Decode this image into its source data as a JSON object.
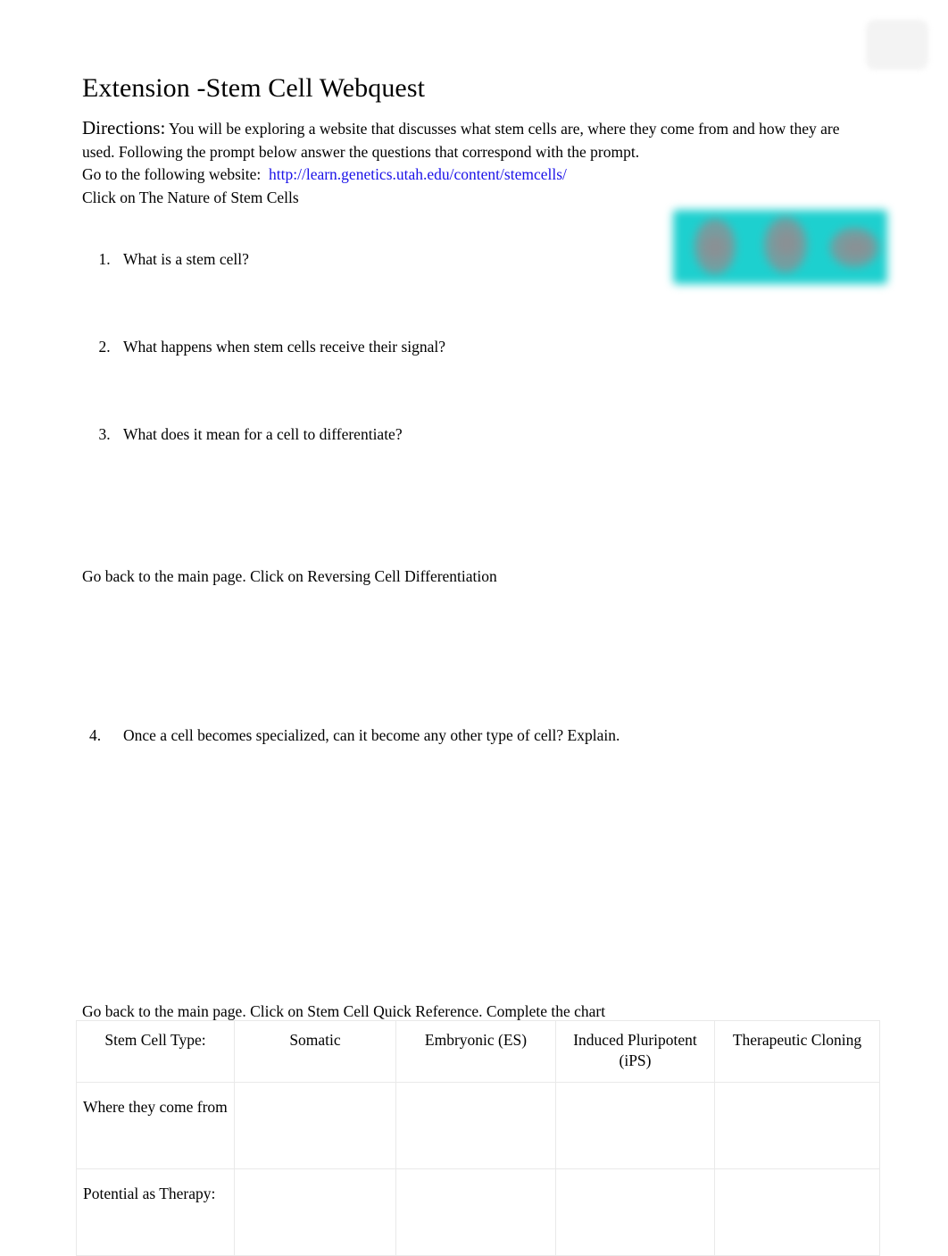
{
  "document": {
    "title": "Extension -Stem Cell Webquest",
    "corner_mark_name": "image-placeholder-icon"
  },
  "directions": {
    "label": "Directions:",
    "body": " You will be exploring a website that discusses what stem cells are, where they come from and how they are used. Following the prompt below answer the questions that correspond with the prompt.",
    "website_prompt": "Go to the following website:",
    "website_url": "http://learn.genetics.utah.edu/content/stemcells/",
    "click_instruction": "Click on The Nature of Stem Cells",
    "link_color": "#1a11e8"
  },
  "figure": {
    "name": "stem-cell-photo",
    "alt": "Blurred teal image of three stem cells",
    "background_color": "#1dd0cf"
  },
  "questions_top": [
    "What is a stem cell?",
    "What happens when stem cells receive their signal?",
    "What does it mean for a cell to differentiate?"
  ],
  "paragraph_reversing": "Go back to the main page. Click on Reversing Cell Differentiation",
  "questions_four": [
    "Once a cell becomes specialized, can it become any other type of cell? Explain."
  ],
  "paragraph_quickref": "Go back to the main page. Click on Stem Cell Quick Reference.  Complete the chart",
  "chart": {
    "headers": [
      "Stem Cell Type:",
      "Somatic",
      "Embryonic (ES)",
      "Induced Pluripotent (iPS)",
      "Therapeutic Cloning"
    ],
    "rows": [
      {
        "label": "Where they come from",
        "cells": [
          "",
          "",
          "",
          ""
        ]
      },
      {
        "label": "Potential as Therapy:",
        "cells": [
          "",
          "",
          "",
          ""
        ]
      }
    ]
  }
}
